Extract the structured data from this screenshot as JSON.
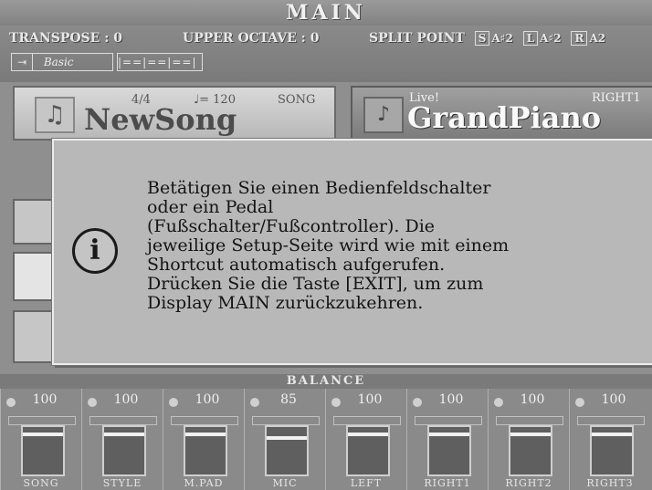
{
  "header": {
    "title": "MAIN"
  },
  "info": {
    "transpose": "TRANSPOSE : 0",
    "upper_octave": "UPPER OCTAVE : 0",
    "split_point": "SPLIT POINT",
    "split_s_tag": "S",
    "split_s_val": "A♯2",
    "split_l_tag": "L",
    "split_l_val": "A♯2",
    "split_r_tag": "R",
    "split_r_val": "A2",
    "mode_label": "Basic",
    "mode_segments": "|==|==|==|"
  },
  "song": {
    "icon": "music-note-icon",
    "time_signature": "4/4",
    "tempo": "♩= 120",
    "label": "SONG",
    "name": "NewSong"
  },
  "voice": {
    "icon": "grand-piano-icon",
    "level_label": "Live!",
    "part_label": "RIGHT1",
    "name": "GrandPiano"
  },
  "dialog": {
    "icon": "info-icon",
    "lines": [
      "Betätigen Sie einen Bedienfeldschalter",
      "oder ein Pedal",
      "(Fußschalter/Fußcontroller). Die",
      "jeweilige Setup-Seite wird wie mit einem",
      "Shortcut automatisch aufgerufen.",
      "Drücken Sie die Taste [EXIT], um zum",
      "Display MAIN zurückzukehren."
    ]
  },
  "balance": {
    "title": "BALANCE",
    "channels": [
      {
        "name": "SONG",
        "value": "100",
        "level": 100
      },
      {
        "name": "STYLE",
        "value": "100",
        "level": 100
      },
      {
        "name": "M.PAD",
        "value": "100",
        "level": 100
      },
      {
        "name": "MIC",
        "value": "85",
        "level": 85
      },
      {
        "name": "LEFT",
        "value": "100",
        "level": 100
      },
      {
        "name": "RIGHT1",
        "value": "100",
        "level": 100
      },
      {
        "name": "RIGHT2",
        "value": "100",
        "level": 100
      },
      {
        "name": "RIGHT3",
        "value": "100",
        "level": 100
      }
    ]
  }
}
